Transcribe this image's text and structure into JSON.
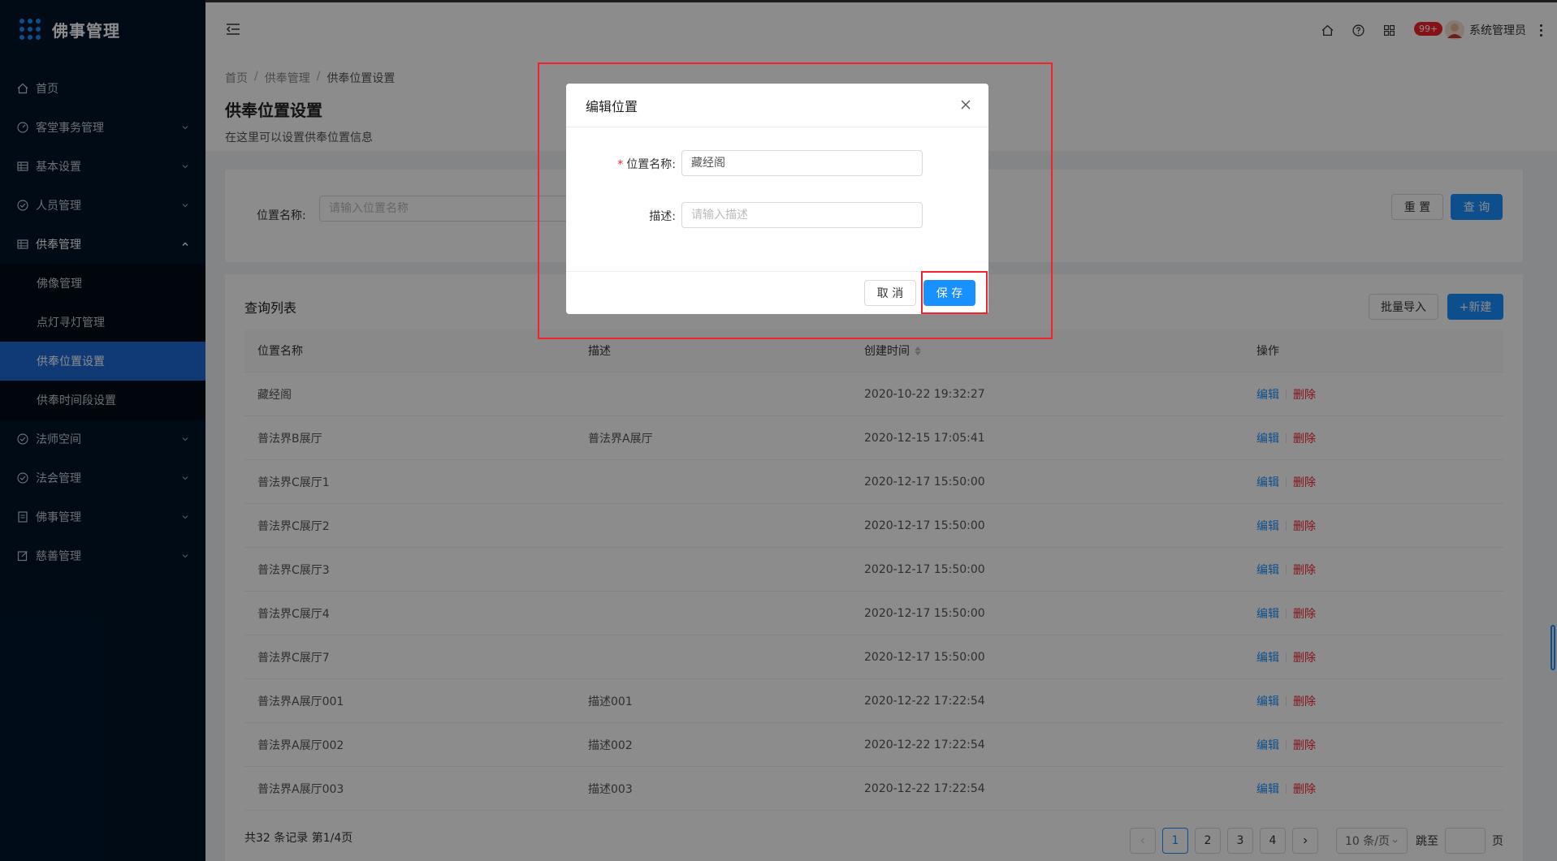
{
  "app": {
    "title": "佛事管理"
  },
  "sidebar": {
    "items": [
      {
        "label": "首页",
        "icon": "home-icon"
      },
      {
        "label": "客堂事务管理",
        "icon": "dashboard-icon"
      },
      {
        "label": "基本设置",
        "icon": "table-icon"
      },
      {
        "label": "人员管理",
        "icon": "check-circle-icon"
      },
      {
        "label": "供奉管理",
        "icon": "table-icon"
      },
      {
        "label": "法师空间",
        "icon": "check-circle-icon"
      },
      {
        "label": "法会管理",
        "icon": "check-circle-icon"
      },
      {
        "label": "佛事管理",
        "icon": "profile-icon"
      },
      {
        "label": "慈善管理",
        "icon": "form-icon"
      }
    ],
    "submenu": [
      {
        "label": "佛像管理"
      },
      {
        "label": "点灯寻灯管理"
      },
      {
        "label": "供奉位置设置"
      },
      {
        "label": "供奉时间段设置"
      }
    ]
  },
  "header": {
    "badge": "99+",
    "username": "系统管理员"
  },
  "breadcrumb": [
    "首页",
    "供奉管理",
    "供奉位置设置"
  ],
  "page": {
    "title": "供奉位置设置",
    "description": "在这里可以设置供奉位置信息"
  },
  "search": {
    "label": "位置名称:",
    "placeholder": "请输入位置名称",
    "reset_label": "重 置",
    "query_label": "查 询"
  },
  "table": {
    "title": "查询列表",
    "import_label": "批量导入",
    "new_label": "+新建",
    "columns": [
      "位置名称",
      "描述",
      "创建时间",
      "操作"
    ],
    "rows": [
      {
        "name": "藏经阁",
        "desc": "",
        "created": "2020-10-22 19:32:27"
      },
      {
        "name": "普法界B展厅",
        "desc": "普法界A展厅",
        "created": "2020-12-15 17:05:41"
      },
      {
        "name": "普法界C展厅1",
        "desc": "",
        "created": "2020-12-17 15:50:00"
      },
      {
        "name": "普法界C展厅2",
        "desc": "",
        "created": "2020-12-17 15:50:00"
      },
      {
        "name": "普法界C展厅3",
        "desc": "",
        "created": "2020-12-17 15:50:00"
      },
      {
        "name": "普法界C展厅4",
        "desc": "",
        "created": "2020-12-17 15:50:00"
      },
      {
        "name": "普法界C展厅7",
        "desc": "",
        "created": "2020-12-17 15:50:00"
      },
      {
        "name": "普法界A展厅001",
        "desc": "描述001",
        "created": "2020-12-22 17:22:54"
      },
      {
        "name": "普法界A展厅002",
        "desc": "描述002",
        "created": "2020-12-22 17:22:54"
      },
      {
        "name": "普法界A展厅003",
        "desc": "描述003",
        "created": "2020-12-22 17:22:54"
      }
    ],
    "edit_label": "编辑",
    "delete_label": "删除"
  },
  "pagination": {
    "total_text": "共32 条记录 第1/4页",
    "pages": [
      "1",
      "2",
      "3",
      "4"
    ],
    "current": "1",
    "page_size": "10 条/页",
    "jump_label": "跳至",
    "page_word": "页"
  },
  "modal": {
    "title": "编辑位置",
    "name_label": "位置名称:",
    "name_value": "藏经阁",
    "desc_label": "描述:",
    "desc_placeholder": "请输入描述",
    "cancel_label": "取 消",
    "save_label": "保 存"
  },
  "colors": {
    "sidebar_bg": "#001529",
    "primary": "#1890ff",
    "danger": "#f5222d",
    "active_menu": "#1e6bd6"
  }
}
